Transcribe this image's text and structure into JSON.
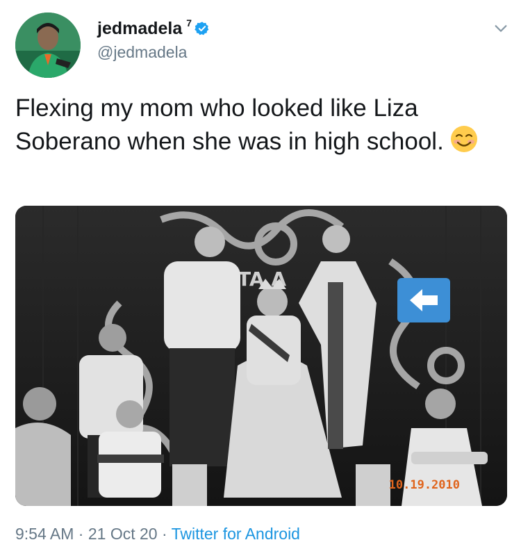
{
  "author": {
    "display_name": "jedmadela",
    "superscript": "7",
    "handle": "@jedmadela",
    "verified": true,
    "avatar_icon": "profile-photo"
  },
  "tweet": {
    "text": "Flexing my mom who looked like Liza Soberano when she was in high school.",
    "emoji": "smiling-face-with-smiling-eyes"
  },
  "media": {
    "kind": "black-and-white photograph of a coronation ceremony",
    "date_stamp": "10.19.2010",
    "overlay_icon": "white-arrow-left-on-blue"
  },
  "footer": {
    "time": "9:54 AM",
    "sep1": " · ",
    "date": "21 Oct 20",
    "sep2": " · ",
    "source": "Twitter for Android"
  },
  "colors": {
    "link": "#1b95e0",
    "secondary_text": "#657786",
    "primary_text": "#14171a",
    "verified_badge": "#1da1f2",
    "date_stamp": "#e0641c"
  }
}
